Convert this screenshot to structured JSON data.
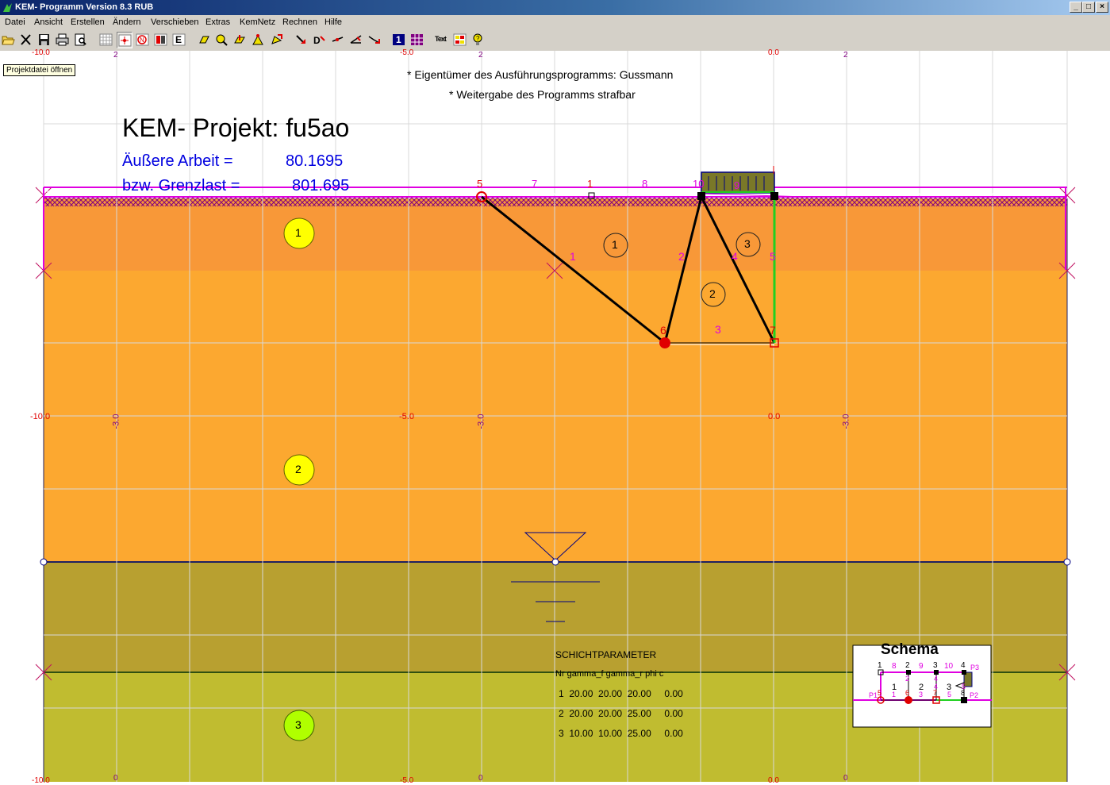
{
  "window": {
    "title": "KEM- Programm Version 8.3 RUB",
    "minimize": "_",
    "restore": "□",
    "close": "×"
  },
  "menu": [
    "Datei",
    "Ansicht",
    "Erstellen",
    "Ändern",
    "Verschieben",
    "Extras",
    "KemNetz",
    "Rechnen",
    "Hilfe"
  ],
  "toolbar": {
    "e_label": "E",
    "layer_1_label": "1",
    "text_label": "Text",
    "tooltip": "Projektdatei öffnen"
  },
  "colors": {
    "titlebar": "#0a246a",
    "layer1": "#f89838",
    "layer2": "#fca830",
    "layer3a": "#b8a030",
    "layer3b": "#c0bc30",
    "load": "#e000e0",
    "mechanism": "#000000",
    "green_line": "#20d020"
  },
  "drawing": {
    "copyright_1": "* Eigentümer des Ausführungsprogramms: Gussmann",
    "copyright_2": "* Weitergabe des Programms strafbar",
    "project_title": "KEM- Projekt: fu5ao",
    "work_label": "Äußere Arbeit =",
    "work_value": "80.1695",
    "limit_label": "bzw. Grenzlast =",
    "limit_value": "801.695",
    "axis_top": [
      "-10.0",
      "2",
      "-5.0",
      "2",
      "0.0",
      "2"
    ],
    "axis_mid": [
      "-10.0",
      "-3.0",
      "-5.0",
      "-3.0",
      "0.0",
      "-3.0"
    ],
    "axis_bottom": [
      "-10.0",
      "0",
      "-5.0",
      "0",
      "0.0",
      "0"
    ],
    "layer_numbers": [
      "1",
      "2",
      "3"
    ],
    "body_numbers": [
      "1",
      "2",
      "3"
    ],
    "node_labels": [
      "5",
      "7",
      "1",
      "8",
      "10",
      "9",
      "6",
      "7"
    ],
    "edge_labels": [
      "1",
      "2",
      "4",
      "5",
      "3"
    ],
    "params": {
      "title": "SCHICHTPARAMETER",
      "header": "Nr gamma_f gamma_r phi c",
      "rows": [
        "1  20.00  20.00  20.00     0.00",
        "2  20.00  20.00  25.00     0.00",
        "3  10.00  10.00  25.00     0.00"
      ]
    },
    "schema": {
      "title": "Schema",
      "top_nodes": [
        "1",
        "8",
        "2",
        "9",
        "3",
        "10",
        "4"
      ],
      "bottom_nodes": [
        "5",
        "1",
        "6",
        "3",
        "7",
        "5",
        "8"
      ],
      "mid_labels": [
        "1",
        "2",
        "3",
        "4"
      ],
      "edge_labels": [
        "2",
        "4",
        "5"
      ],
      "p3": "P3",
      "p1": "P1",
      "p2": "P2"
    }
  }
}
